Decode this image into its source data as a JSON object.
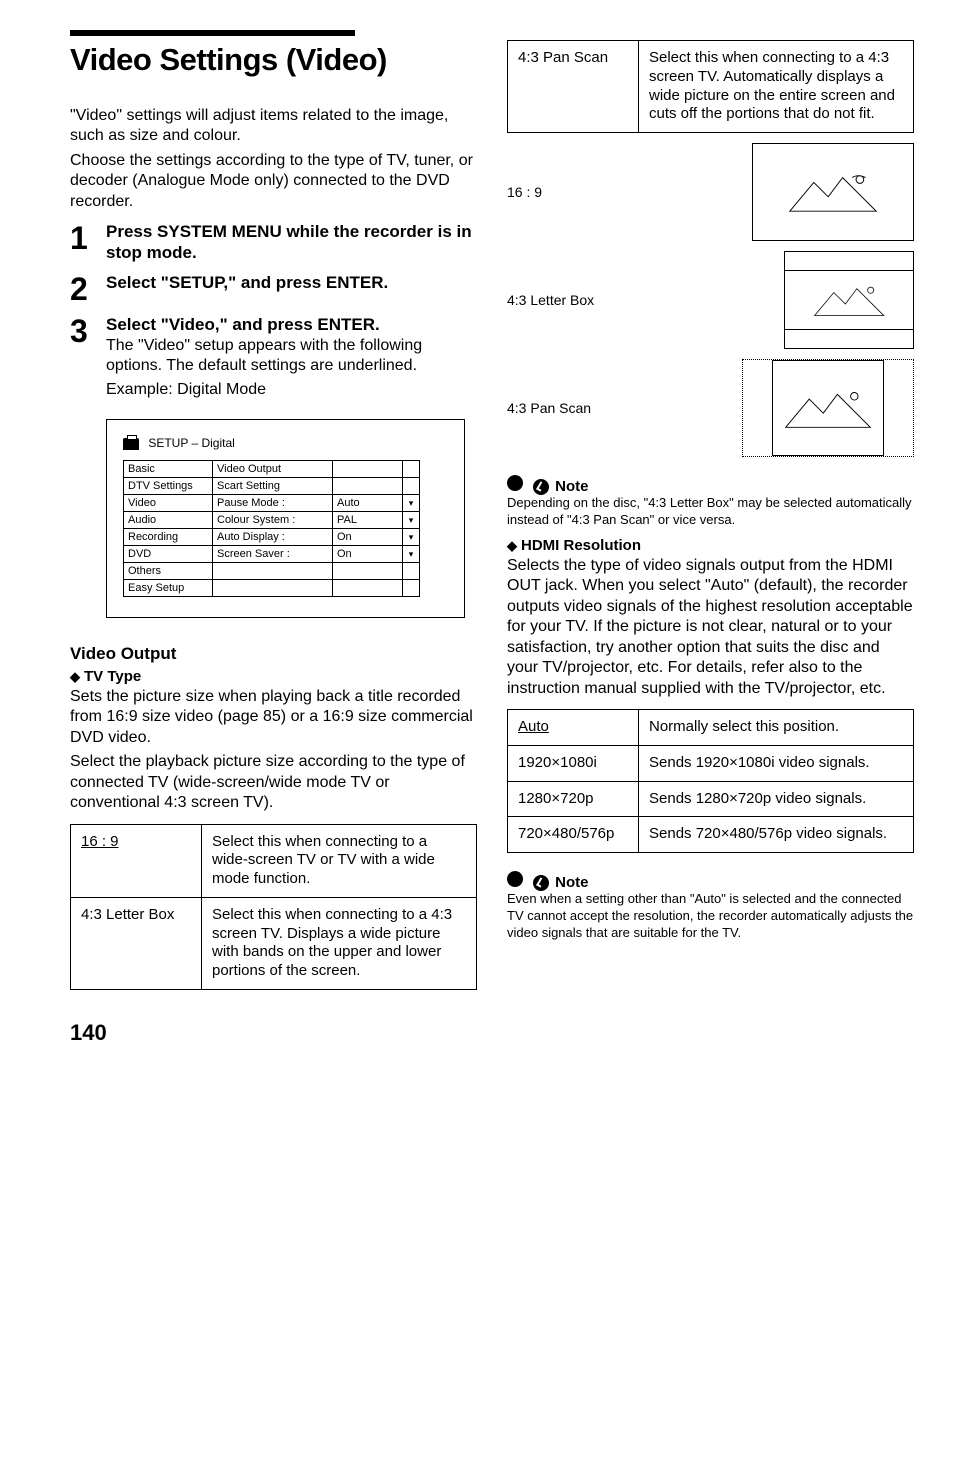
{
  "left": {
    "title": "Video Settings (Video)",
    "intro1": "\"Video\" settings will adjust items related to the image, such as size and colour.",
    "intro2": "Choose the settings according to the type of TV, tuner, or decoder (Analogue Mode only) connected to the DVD recorder.",
    "steps": [
      {
        "num": "1",
        "head": "Press SYSTEM MENU while the recorder is in stop mode.",
        "body": ""
      },
      {
        "num": "2",
        "head": "Select \"SETUP,\" and press ENTER.",
        "body": ""
      },
      {
        "num": "3",
        "head": "Select \"Video,\" and press ENTER.",
        "body": "The \"Video\" setup appears with the following options. The default settings are underlined.",
        "body2": "Example: Digital Mode"
      }
    ],
    "setup": {
      "title": "SETUP – Digital",
      "leftcol": [
        "Basic",
        "DTV Settings",
        "Video",
        "Audio",
        "Recording",
        "DVD",
        "Others",
        "Easy Setup"
      ],
      "midcol": [
        "Video Output",
        "Scart Setting",
        "Pause Mode :",
        "Colour System :",
        "Auto Display :",
        "Screen Saver :",
        "",
        ""
      ],
      "rightcol": [
        "",
        "",
        "Auto",
        "PAL",
        "On",
        "On",
        "",
        ""
      ]
    },
    "videoOutputHead": "Video Output",
    "tvTypeHead": "TV Type",
    "tvTypeP1": "Sets the picture size when playing back a title recorded from 16:9 size video (page 85) or a 16:9 size commercial DVD video.",
    "tvTypeP2": "Select the playback picture size according to the type of connected TV (wide-screen/wide mode TV or conventional 4:3 screen TV).",
    "table1": [
      {
        "k": "16 : 9",
        "u": true,
        "v": "Select this when connecting to a wide-screen TV or TV with a wide mode function."
      },
      {
        "k": "4:3 Letter Box",
        "v": "Select this when connecting to a 4:3 screen TV. Displays a wide picture with bands on the upper and lower portions of the screen."
      }
    ]
  },
  "right": {
    "table1cont": [
      {
        "k": "4:3 Pan Scan",
        "v": "Select this when connecting to a 4:3 screen TV. Automatically displays a wide picture on the entire screen and cuts off the portions that do not fit."
      }
    ],
    "aspects": [
      {
        "label": "16 : 9"
      },
      {
        "label": "4:3 Letter Box"
      },
      {
        "label": "4:3 Pan Scan"
      }
    ],
    "note1Head": "Note",
    "note1Body": "Depending on the disc, \"4:3 Letter Box\" may be selected automatically instead of \"4:3 Pan Scan\" or vice versa.",
    "hdmiHead": "HDMI Resolution",
    "hdmiBody": "Selects the type of video signals output from the HDMI OUT jack. When you select \"Auto\" (default), the recorder outputs video signals of the highest resolution acceptable for your TV. If the picture is not clear, natural or to your satisfaction, try another option that suits the disc and your TV/projector, etc. For details, refer also to the instruction manual supplied with the TV/projector, etc.",
    "table2": [
      {
        "k": "Auto",
        "u": true,
        "v": "Normally select this position."
      },
      {
        "k": "1920×1080i",
        "v": "Sends 1920×1080i video signals."
      },
      {
        "k": "1280×720p",
        "v": "Sends 1280×720p video signals."
      },
      {
        "k": "720×480/576p",
        "v": "Sends 720×480/576p video signals."
      }
    ],
    "note2Head": "Note",
    "note2Body": "Even when a setting other than \"Auto\" is selected and the connected TV cannot accept the resolution, the recorder automatically adjusts the video signals that are suitable for the TV."
  },
  "pagenum": "140"
}
